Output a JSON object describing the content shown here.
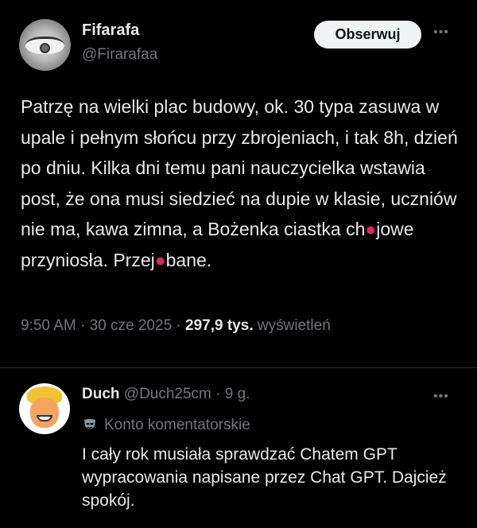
{
  "tweet": {
    "display_name": "Fifarafa",
    "handle": "@Firarafaa",
    "follow_label": "Obserwuj",
    "more_label": "•••",
    "text": {
      "part1": "Patrzę na wielki plac budowy, ok. 30 typa zasuwa w upale i pełnym słońcu przy zbrojeniach, i tak 8h, dzień po dniu. Kilka dni temu pani nauczycielka wstawia post, że ona musi siedzieć na dupie w klasie, uczniów nie ma, kawa zimna, a Bożenka ciastka ch",
      "censor1": "●",
      "part2": "jowe przyniosła. Przej",
      "censor2": "●",
      "part3": "bane."
    },
    "time": "9:50 AM",
    "separator": "·",
    "date": "30 cze 2025",
    "views_count": "297,9 tys.",
    "views_label": "wyświetleń"
  },
  "reply": {
    "display_name": "Duch",
    "handle": "@Duch25cm",
    "separator": "·",
    "age": "9 g.",
    "more_label": "•••",
    "badge_icon": "mask-icon",
    "badge_text": "Konto komentatorskie",
    "text": "I cały rok musiała sprawdzać Chatem GPT wypracowania napisane przez Chat GPT. Dajcież spokój."
  }
}
